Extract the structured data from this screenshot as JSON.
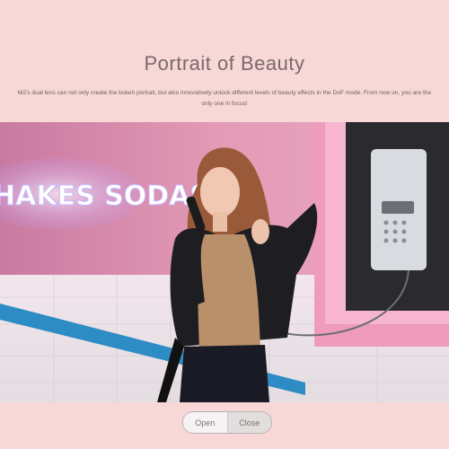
{
  "header": {
    "title": "Portrait of Beauty",
    "description": "M2's dual lens can not only create the bokeh portrait, but also innovatively unlock different levels of beauty effects in the DoF mode. From now on, you are the only one in focus!"
  },
  "photo": {
    "neon_sign_text": "HAKES SODAS"
  },
  "toggle": {
    "open_label": "Open",
    "close_label": "Close"
  }
}
